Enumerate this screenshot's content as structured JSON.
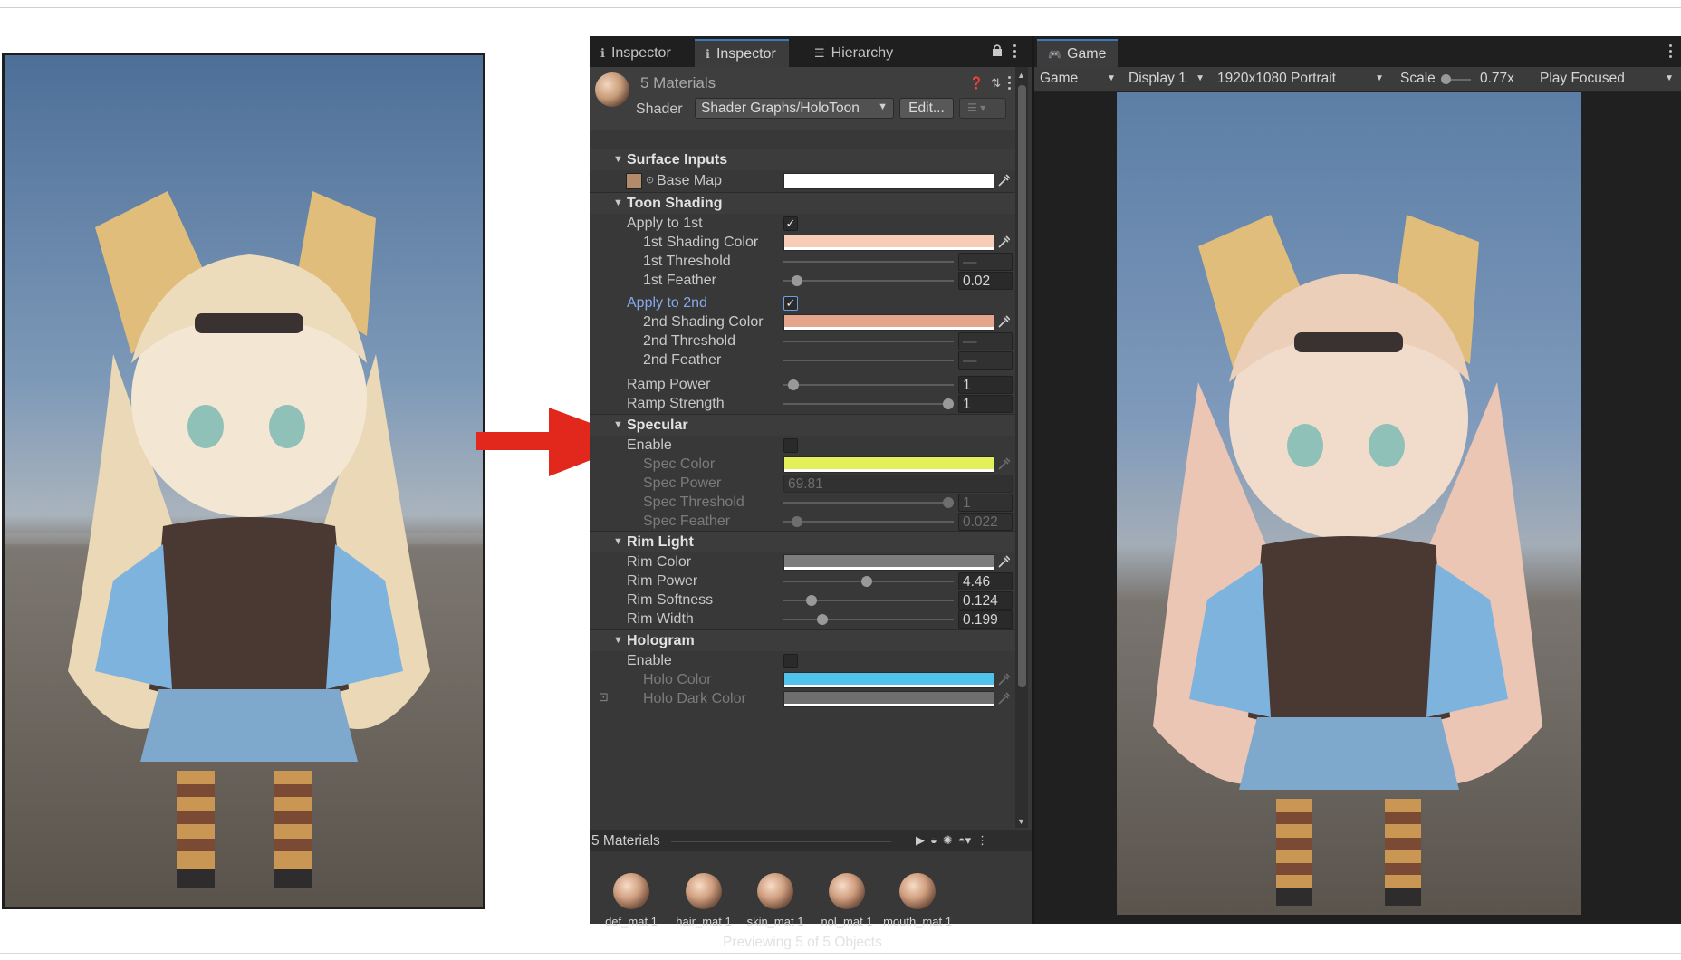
{
  "inspector": {
    "tabs": [
      {
        "label": "Inspector"
      },
      {
        "label": "Inspector"
      },
      {
        "label": "Hierarchy"
      }
    ],
    "material_title": "5 Materials",
    "shader_label": "Shader",
    "shader_value": "Shader Graphs/HoloToon",
    "edit_label": "Edit...",
    "sections": {
      "surface": "Surface Inputs",
      "toon": "Toon Shading",
      "specular": "Specular",
      "rim": "Rim Light",
      "hologram": "Hologram"
    },
    "labels": {
      "base_map": "Base Map",
      "apply_1st": "Apply to 1st",
      "shade1_color": "1st Shading Color",
      "shade1_threshold": "1st Threshold",
      "shade1_feather": "1st Feather",
      "apply_2nd": "Apply to 2nd",
      "shade2_color": "2nd Shading Color",
      "shade2_threshold": "2nd Threshold",
      "shade2_feather": "2nd Feather",
      "ramp_power": "Ramp Power",
      "ramp_strength": "Ramp Strength",
      "spec_enable": "Enable",
      "spec_color": "Spec Color",
      "spec_power": "Spec Power",
      "spec_threshold": "Spec Threshold",
      "spec_feather": "Spec Feather",
      "rim_color": "Rim Color",
      "rim_power": "Rim Power",
      "rim_softness": "Rim Softness",
      "rim_width": "Rim Width",
      "holo_enable": "Enable",
      "holo_color": "Holo Color",
      "holo_dark_color": "Holo Dark Color"
    },
    "values": {
      "shade1_threshold": "—",
      "shade1_feather": "0.02",
      "shade2_threshold": "—",
      "shade2_feather": "—",
      "ramp_power": "1",
      "ramp_strength": "1",
      "spec_power": "69.81",
      "spec_threshold": "1",
      "spec_feather": "0.022",
      "rim_power": "4.46",
      "rim_softness": "0.124",
      "rim_width": "0.199"
    },
    "slider_fractions": {
      "shade1_feather": 0.05,
      "ramp_power": 0.03,
      "ramp_strength": 1.0,
      "spec_threshold": 1.0,
      "spec_feather": 0.05,
      "rim_power": 0.49,
      "rim_softness": 0.14,
      "rim_width": 0.21
    },
    "colors": {
      "base_map": "#ffffff",
      "shade1_color": "#f7cdb8",
      "shade2_color": "#e5a58c",
      "spec_color": "#e4f059",
      "rim_color": "#7d7d7d",
      "holo_color": "#4fc3eb",
      "holo_dark_color": "#6e6e6e"
    },
    "checkboxes": {
      "apply_1st": true,
      "apply_2nd": true,
      "spec_enable": false,
      "holo_enable": false
    }
  },
  "materials_bar": {
    "label": "5 Materials",
    "items": [
      {
        "name": "def_mat 1"
      },
      {
        "name": "hair_mat 1"
      },
      {
        "name": "skin_mat 1"
      },
      {
        "name": "nol_mat 1"
      },
      {
        "name": "mouth_mat 1"
      }
    ],
    "previewing": "Previewing 5 of 5 Objects"
  },
  "game": {
    "tab": "Game",
    "view_dropdown": "Game",
    "display_dropdown": "Display 1",
    "resolution_dropdown": "1920x1080 Portrait",
    "scale_label": "Scale",
    "scale_value": "0.77x",
    "play_mode_dropdown": "Play Focused"
  },
  "icons": [
    "info-icon",
    "hierarchy-icon",
    "lock-icon",
    "kebab-icon",
    "help-icon",
    "preset-icon",
    "eyedropper-icon",
    "gamepad-icon",
    "play-icon",
    "arrow-icon"
  ]
}
